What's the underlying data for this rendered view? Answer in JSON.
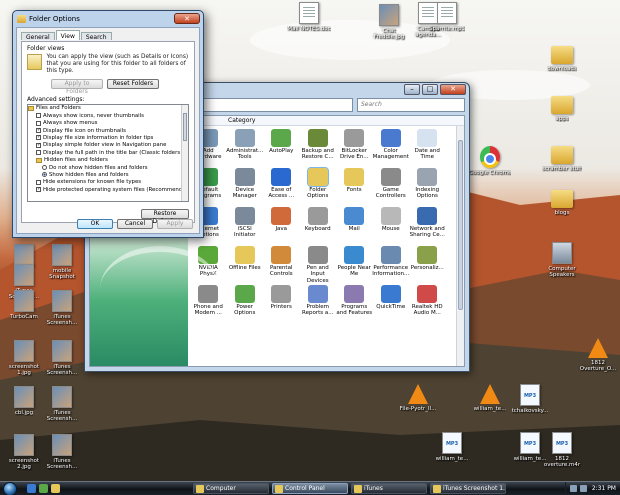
{
  "desktop": {
    "icons": [
      {
        "label": "Mail NOTES.doc",
        "type": "doc"
      },
      {
        "label": "Chat Freddie.jpg",
        "type": "img"
      },
      {
        "label": "Camera agenda...",
        "type": "doc"
      },
      {
        "label": "Sparrite.mp3",
        "type": "doc"
      },
      {
        "label": "downloads",
        "type": "folder"
      },
      {
        "label": "apps",
        "type": "folder"
      },
      {
        "label": "Google Chrome",
        "type": "chrome"
      },
      {
        "label": "scramber stuff",
        "type": "folder"
      },
      {
        "label": "blogs",
        "type": "folder"
      },
      {
        "label": "Computer Speakers",
        "type": "pc"
      },
      {
        "label": "Firefox",
        "type": "img"
      },
      {
        "label": "mobile Snapshot",
        "type": "img"
      },
      {
        "label": "iTunes Screensh...",
        "type": "img"
      },
      {
        "label": "TurboCam",
        "type": "img"
      },
      {
        "label": "iTunes Screensh...",
        "type": "img"
      },
      {
        "label": "screenshot 1.jpg",
        "type": "img"
      },
      {
        "label": "iTunes Screensh...",
        "type": "img"
      },
      {
        "label": "cbl.jpg",
        "type": "img"
      },
      {
        "label": "iTunes Screensh...",
        "type": "img"
      },
      {
        "label": "screenshot 2.jpg",
        "type": "img"
      },
      {
        "label": "iTunes Screensh...",
        "type": "img"
      },
      {
        "label": "File-Pyotr_Il...",
        "type": "vlc"
      },
      {
        "label": "william_te...",
        "type": "vlc"
      },
      {
        "label": "tchaikovsky...",
        "type": "mp3"
      },
      {
        "label": "1812 Overture_O...",
        "type": "vlc"
      },
      {
        "label": "william_te...",
        "type": "mp3"
      },
      {
        "label": "william_te...",
        "type": "mp3"
      },
      {
        "label": "1812 overture.m4r",
        "type": "mp3"
      }
    ]
  },
  "control_panel": {
    "search_placeholder": "Search",
    "column_header": "Category",
    "items": [
      {
        "name": "Add Hardware",
        "color": "#7a9ab8"
      },
      {
        "name": "Administrat... Tools",
        "color": "#8aa0b6"
      },
      {
        "name": "AutoPlay",
        "color": "#5aa84a"
      },
      {
        "name": "Backup and Restore C...",
        "color": "#6a8a3a"
      },
      {
        "name": "BitLocker Drive En...",
        "color": "#9a9a9a"
      },
      {
        "name": "Color Management",
        "color": "#4a7ad0"
      },
      {
        "name": "Date and Time",
        "color": "#d6e2f0"
      },
      {
        "name": "Default Programs",
        "color": "#3a9a4a"
      },
      {
        "name": "Device Manager",
        "color": "#7a8a9a"
      },
      {
        "name": "Ease of Access ...",
        "color": "#2a6ad0"
      },
      {
        "name": "Folder Options",
        "color": "#e6c85a"
      },
      {
        "name": "Fonts",
        "color": "#e6c85a"
      },
      {
        "name": "Game Controllers",
        "color": "#8a8a8a"
      },
      {
        "name": "Indexing Options",
        "color": "#9aa4b0"
      },
      {
        "name": "Internet Options",
        "color": "#3a7ad0"
      },
      {
        "name": "iSCSI Initiator",
        "color": "#7a8a9a"
      },
      {
        "name": "Java",
        "color": "#d06a3a"
      },
      {
        "name": "Keyboard",
        "color": "#9a9a9a"
      },
      {
        "name": "Mail",
        "color": "#4a8ad0"
      },
      {
        "name": "Mouse",
        "color": "#b8b8b8"
      },
      {
        "name": "Network and Sharing Ce...",
        "color": "#3a6ab0"
      },
      {
        "name": "NVIDIA PhysX",
        "color": "#5aa83a"
      },
      {
        "name": "Offline Files",
        "color": "#e6c85a"
      },
      {
        "name": "Parental Controls",
        "color": "#d08a3a"
      },
      {
        "name": "Pen and Input Devices",
        "color": "#8a8a8a"
      },
      {
        "name": "People Near Me",
        "color": "#3a8ad0"
      },
      {
        "name": "Performance Information...",
        "color": "#6a8ab0"
      },
      {
        "name": "Personaliz...",
        "color": "#8aa04a"
      },
      {
        "name": "Phone and Modem ...",
        "color": "#8a8a8a"
      },
      {
        "name": "Power Options",
        "color": "#5aa84a"
      },
      {
        "name": "Printers",
        "color": "#9a9a9a"
      },
      {
        "name": "Problem Reports a...",
        "color": "#6a8ad0"
      },
      {
        "name": "Programs and Features",
        "color": "#8a7ab0"
      },
      {
        "name": "QuickTime",
        "color": "#3a7ad0"
      },
      {
        "name": "Realtek HD Audio M...",
        "color": "#d04a4a"
      }
    ]
  },
  "folder_options": {
    "title": "Folder Options",
    "close": "✕",
    "tabs": [
      "General",
      "View",
      "Search"
    ],
    "folder_views_label": "Folder views",
    "folder_views_text": "You can apply the view (such as Details or Icons) that you are using for this folder to all folders of this type.",
    "apply_to_folders": "Apply to Folders",
    "reset_folders": "Reset Folders",
    "advanced_label": "Advanced settings:",
    "advanced_items": [
      {
        "text": "Files and Folders",
        "kind": "folder",
        "checked": false,
        "indent": 0
      },
      {
        "text": "Always show icons, never thumbnails",
        "kind": "check",
        "checked": false,
        "indent": 1
      },
      {
        "text": "Always show menus",
        "kind": "check",
        "checked": false,
        "indent": 1
      },
      {
        "text": "Display file icon on thumbnails",
        "kind": "check",
        "checked": true,
        "indent": 1
      },
      {
        "text": "Display file size information in folder tips",
        "kind": "check",
        "checked": true,
        "indent": 1
      },
      {
        "text": "Display simple folder view in Navigation pane",
        "kind": "check",
        "checked": true,
        "indent": 1
      },
      {
        "text": "Display the full path in the title bar (Classic folders only)",
        "kind": "check",
        "checked": false,
        "indent": 1
      },
      {
        "text": "Hidden files and folders",
        "kind": "folder",
        "checked": false,
        "indent": 1
      },
      {
        "text": "Do not show hidden files and folders",
        "kind": "radio",
        "checked": false,
        "indent": 2
      },
      {
        "text": "Show hidden files and folders",
        "kind": "radio",
        "checked": true,
        "indent": 2
      },
      {
        "text": "Hide extensions for known file types",
        "kind": "check",
        "checked": false,
        "indent": 1
      },
      {
        "text": "Hide protected operating system files (Recommended)",
        "kind": "check",
        "checked": true,
        "indent": 1
      }
    ],
    "restore_defaults": "Restore Defaults",
    "ok": "OK",
    "cancel": "Cancel",
    "apply": "Apply"
  },
  "taskbar": {
    "tasks": [
      {
        "label": "Computer",
        "active": false
      },
      {
        "label": "Control Panel",
        "active": true
      },
      {
        "label": "iTunes",
        "active": false
      },
      {
        "label": "iTunes Screenshot 1...",
        "active": false
      }
    ],
    "clock": "2:31 PM"
  }
}
